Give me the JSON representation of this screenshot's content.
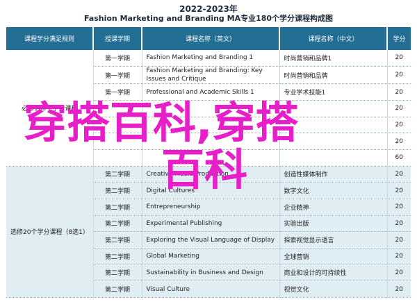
{
  "header": {
    "year": "2022-2023年",
    "title": "Fashion Marketing and Branding MA专业180个学分课程构成图"
  },
  "table": {
    "columns": [
      "课程学分满足规则",
      "授课学期",
      "课程名称（英文）",
      "课程名称（中文）",
      "学分"
    ],
    "groups": [
      {
        "label": "必修160个学分课程",
        "rows": [
          {
            "semester": "第一学期",
            "en": "Fashion Marketing and Branding 1",
            "zh": "时尚营销和品牌1",
            "credits": "20"
          },
          {
            "semester": "第一学期",
            "en": "Fashion Marketing and Branding: Key Issues and Critique",
            "zh": "时尚营销和品牌",
            "credits": "20"
          },
          {
            "semester": "第一学期",
            "en": "Professional and Academic Skills 1",
            "zh": "专业学术技能1",
            "credits": "20"
          },
          {
            "semester": "",
            "en": "",
            "zh": "",
            "credits": "20"
          },
          {
            "semester": "",
            "en": "",
            "zh": "",
            "credits": "20"
          },
          {
            "semester": "",
            "en": "",
            "zh": "",
            "credits": "20"
          },
          {
            "semester": "",
            "en": "",
            "zh": "",
            "credits": "60"
          }
        ]
      },
      {
        "label": "选修20个学分课程（8选1）",
        "rows": [
          {
            "semester": "第二学期",
            "en": "Creative Media Production",
            "zh": "创造性媒体制作",
            "credits": "20"
          },
          {
            "semester": "第二学期",
            "en": "Digital Cultures",
            "zh": "数字文化",
            "credits": "20"
          },
          {
            "semester": "第二学期",
            "en": "Entrepreneurship",
            "zh": "企业精神",
            "credits": "20"
          },
          {
            "semester": "第二学期",
            "en": "Experimental Publishing",
            "zh": "实验出版",
            "credits": "20"
          },
          {
            "semester": "第二学期",
            "en": "Exploring the Visual Language of Display",
            "zh": "探索视觉显示语言",
            "credits": "20"
          },
          {
            "semester": "第二学期",
            "en": "Global Marketing",
            "zh": "全球营销",
            "credits": "20"
          },
          {
            "semester": "第二学期",
            "en": "Sustainability in Business and Design",
            "zh": "商业和设计的可持续性",
            "credits": "20"
          },
          {
            "semester": "第二学期",
            "en": "Visual Culture",
            "zh": "视觉文化",
            "credits": "20"
          }
        ]
      }
    ]
  },
  "watermark": {
    "line1": "穿搭百科,穿搭",
    "line2": "百科",
    "color": "#e61fc8"
  },
  "colors": {
    "header_bg": "#236e94",
    "elective_bg": "#e0eef4"
  }
}
